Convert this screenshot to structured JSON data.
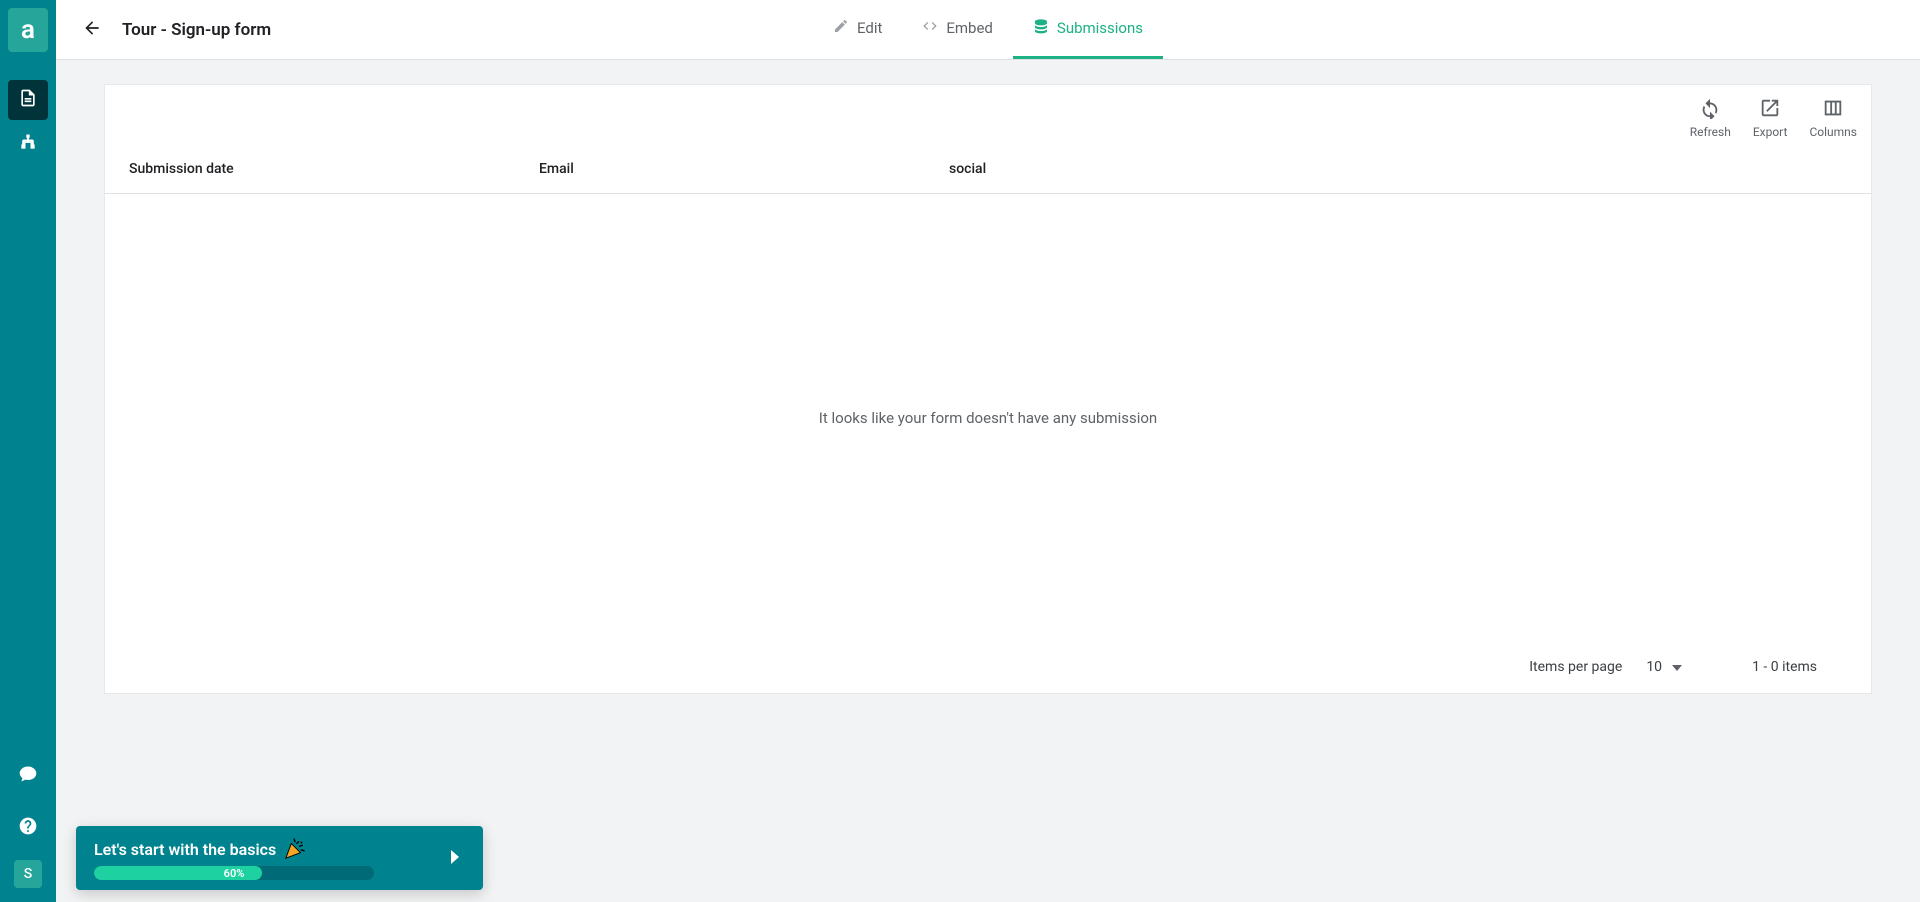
{
  "sidebar": {
    "logo": "a",
    "avatar_initial": "S"
  },
  "header": {
    "title": "Tour - Sign-up form",
    "tabs": {
      "edit": "Edit",
      "embed": "Embed",
      "submissions": "Submissions"
    }
  },
  "toolbar": {
    "refresh": "Refresh",
    "export": "Export",
    "columns": "Columns"
  },
  "table": {
    "headers": {
      "date": "Submission date",
      "email": "Email",
      "social": "social"
    },
    "empty": "It looks like your form doesn't have any submission"
  },
  "pagination": {
    "items_per_page": "Items per page",
    "per_page_value": "10",
    "range": "1 - 0 items"
  },
  "onboarding": {
    "title": "Let's start with the basics",
    "progress_pct": "60%",
    "progress_width": "60%"
  }
}
